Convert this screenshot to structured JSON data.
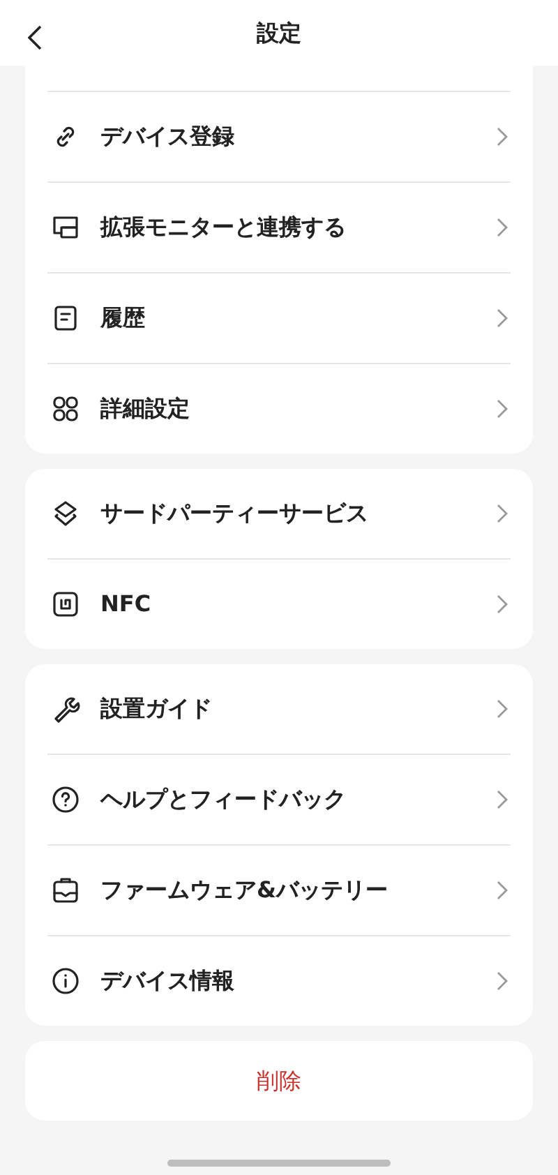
{
  "header": {
    "title": "設定"
  },
  "sections": [
    {
      "items": [
        {
          "label": "デバイス登録"
        },
        {
          "label": "拡張モニターと連携する"
        },
        {
          "label": "履歴"
        },
        {
          "label": "詳細設定"
        }
      ]
    },
    {
      "items": [
        {
          "label": "サードパーティーサービス"
        },
        {
          "label": "NFC"
        }
      ]
    },
    {
      "items": [
        {
          "label": "設置ガイド"
        },
        {
          "label": "ヘルプとフィードバック"
        },
        {
          "label": "ファームウェア&バッテリー"
        },
        {
          "label": "デバイス情報"
        }
      ]
    }
  ],
  "delete_button": {
    "label": "削除"
  }
}
